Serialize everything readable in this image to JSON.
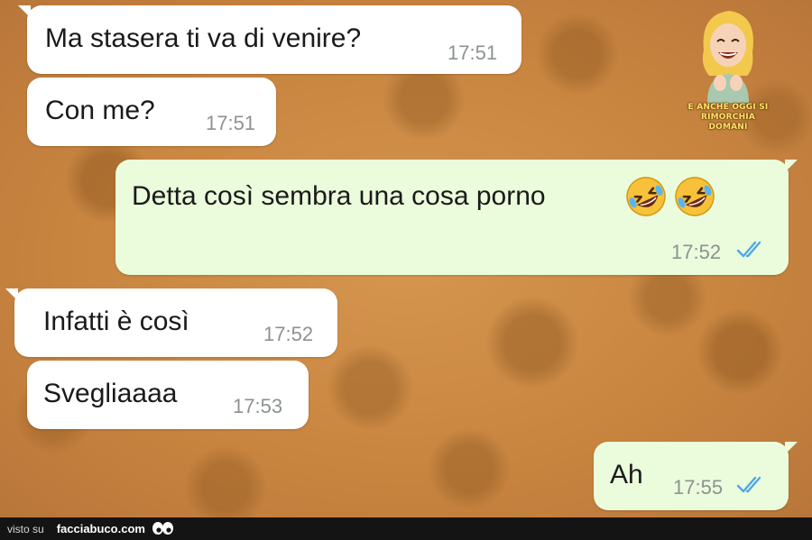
{
  "conversation": {
    "messages": [
      {
        "direction": "in",
        "text": "Ma stasera ti va di venire?",
        "time": "17:51"
      },
      {
        "direction": "in",
        "text": "Con me?",
        "time": "17:51"
      },
      {
        "direction": "out",
        "text": "Detta così sembra una cosa porno",
        "emojis": [
          "rolling-on-floor-laughing-emoji",
          "rolling-on-floor-laughing-emoji"
        ],
        "time": "17:52",
        "status": "read"
      },
      {
        "direction": "in",
        "text": "Infatti è così",
        "time": "17:52"
      },
      {
        "direction": "in",
        "text": "Svegliaaaa",
        "time": "17:53"
      },
      {
        "direction": "out",
        "text": "Ah",
        "time": "17:55",
        "status": "read"
      }
    ]
  },
  "watermark": {
    "logo_icon": "laughing-woman-icon",
    "caption": "E ANCHE OGGI SI RIMORCHIA DOMANI"
  },
  "footer": {
    "prefix": "visto su",
    "site": "facciabuco.com",
    "icon": "eyes-icon"
  },
  "colors": {
    "incoming_bubble": "#ffffff",
    "outgoing_bubble": "#eafcdc",
    "read_ticks": "#4fa6e8",
    "timestamp": "#8c9290",
    "wallpaper": "#c98a45"
  }
}
